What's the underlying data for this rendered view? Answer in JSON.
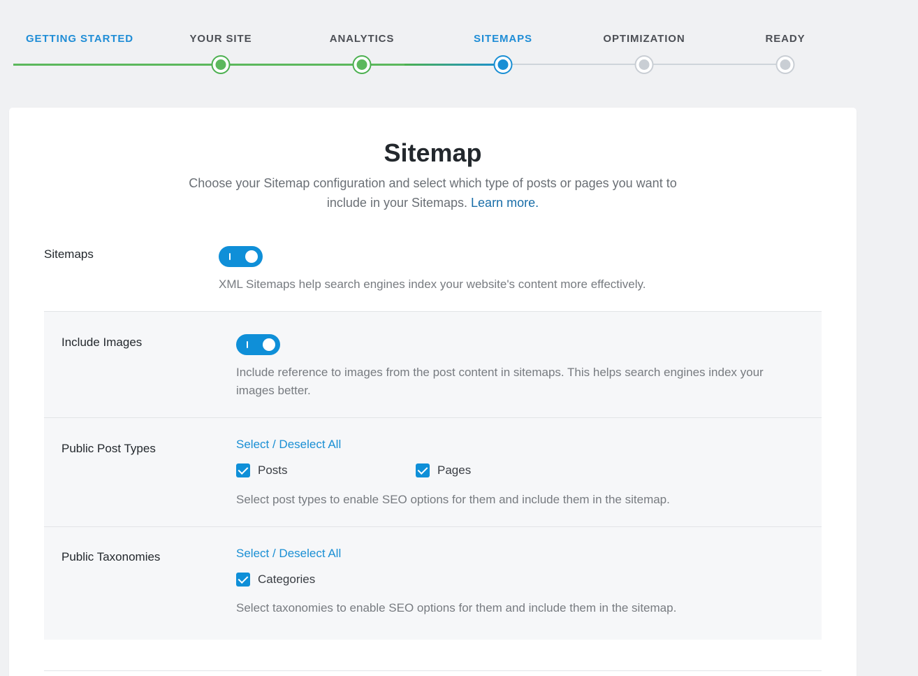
{
  "stepper": {
    "steps": [
      {
        "label": "GETTING STARTED",
        "state": "done"
      },
      {
        "label": "YOUR SITE",
        "state": "done"
      },
      {
        "label": "ANALYTICS",
        "state": "done"
      },
      {
        "label": "SITEMAPS",
        "state": "active"
      },
      {
        "label": "OPTIMIZATION",
        "state": "todo"
      },
      {
        "label": "READY",
        "state": "todo"
      }
    ],
    "colors": {
      "done": "#5cb85c",
      "active": "#1a8fd4",
      "todo": "#c9ced4"
    }
  },
  "card": {
    "title": "Sitemap",
    "subtitle": "Choose your Sitemap configuration and select which type of posts or pages you want to include in your Sitemaps.",
    "learn_more": "Learn more."
  },
  "sitemaps": {
    "label": "Sitemaps",
    "enabled": true,
    "help": "XML Sitemaps help search engines index your website's content more effectively."
  },
  "include_images": {
    "label": "Include Images",
    "enabled": true,
    "help": "Include reference to images from the post content in sitemaps. This helps search engines index your images better."
  },
  "post_types": {
    "label": "Public Post Types",
    "select_all": "Select / Deselect All",
    "options": [
      {
        "label": "Posts",
        "checked": true
      },
      {
        "label": "Pages",
        "checked": true
      }
    ],
    "help": "Select post types to enable SEO options for them and include them in the sitemap."
  },
  "taxonomies": {
    "label": "Public Taxonomies",
    "select_all": "Select / Deselect All",
    "options": [
      {
        "label": "Categories",
        "checked": true
      }
    ],
    "help": "Select taxonomies to enable SEO options for them and include them in the sitemap."
  },
  "accent_color": "#0f8fd8"
}
